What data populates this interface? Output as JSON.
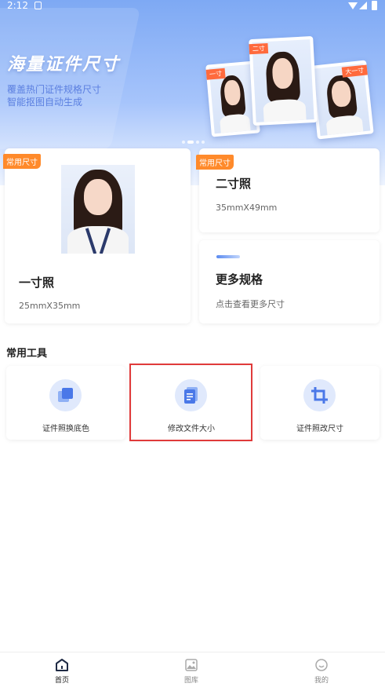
{
  "status_bar": {
    "time": "2:12"
  },
  "banner": {
    "title": "海量证件尺寸",
    "subtitle_1": "覆盖热门证件规格尺寸",
    "subtitle_2": "智能抠图自动生成",
    "photo_tags": [
      "一寸",
      "二寸",
      "大一寸"
    ]
  },
  "cards": {
    "one_inch": {
      "badge": "常用尺寸",
      "title": "一寸照",
      "size": "25mmX35mm"
    },
    "two_inch": {
      "badge": "常用尺寸",
      "title": "二寸照",
      "size": "35mmX49mm"
    },
    "more": {
      "title": "更多规格",
      "desc": "点击查看更多尺寸"
    }
  },
  "tools": {
    "heading": "常用工具",
    "items": [
      {
        "label": "证件照换底色",
        "icon": "layers-icon"
      },
      {
        "label": "修改文件大小",
        "icon": "document-icon"
      },
      {
        "label": "证件照改尺寸",
        "icon": "crop-icon"
      }
    ]
  },
  "tabbar": {
    "items": [
      {
        "label": "首页",
        "icon": "home-icon",
        "active": true
      },
      {
        "label": "图库",
        "icon": "gallery-icon",
        "active": false
      },
      {
        "label": "我的",
        "icon": "profile-icon",
        "active": false
      }
    ]
  },
  "colors": {
    "accent": "#5b7fe0",
    "badge": "#ff8a2b",
    "highlight": "#e03a3a"
  }
}
